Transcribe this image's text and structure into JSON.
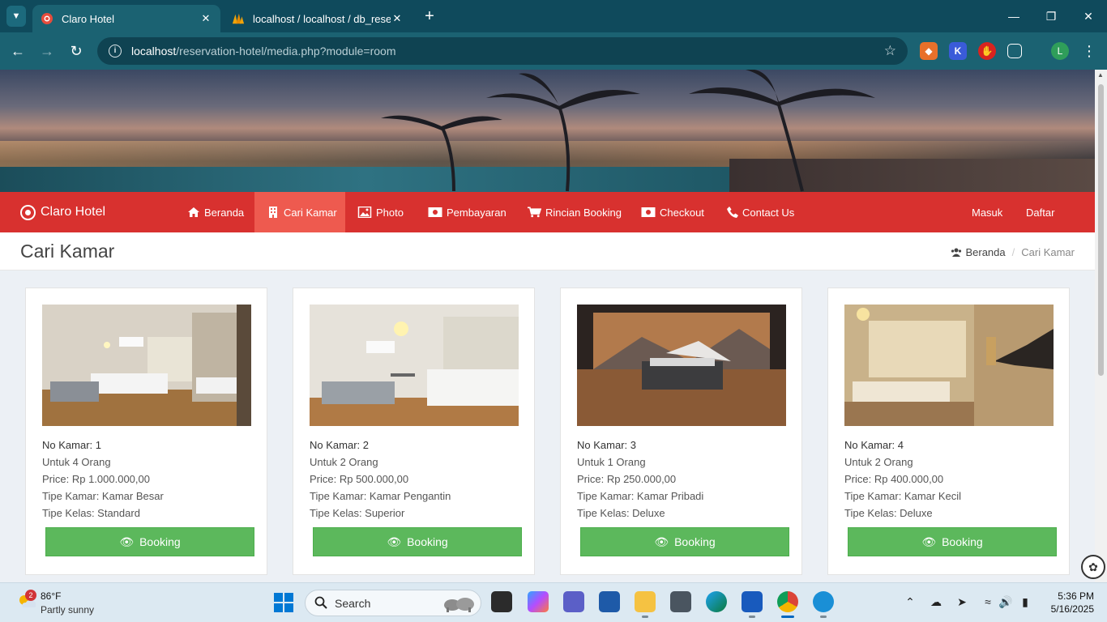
{
  "browser": {
    "tabs": [
      {
        "title": "Claro Hotel",
        "active": true
      },
      {
        "title": "localhost / localhost / db_reservation",
        "active": false
      }
    ],
    "url_host": "localhost",
    "url_path": "/reservation-hotel/media.php?module=room",
    "profile_initial": "L"
  },
  "site": {
    "brand": "Claro Hotel",
    "menu": [
      {
        "label": "Beranda",
        "icon": "home-icon",
        "active": false
      },
      {
        "label": "Cari Kamar",
        "icon": "building-icon",
        "active": true
      },
      {
        "label": "Photo",
        "icon": "image-icon",
        "active": false
      },
      {
        "label": "Pembayaran",
        "icon": "money-icon",
        "active": false
      },
      {
        "label": "Rincian Booking",
        "icon": "cart-icon",
        "active": false
      },
      {
        "label": "Checkout",
        "icon": "money-icon",
        "active": false
      },
      {
        "label": "Contact Us",
        "icon": "phone-icon",
        "active": false
      }
    ],
    "auth": {
      "login": "Masuk",
      "register": "Daftar"
    },
    "page_title": "Cari Kamar",
    "breadcrumb": {
      "home": "Beranda",
      "current": "Cari Kamar"
    },
    "booking_label": "Booking",
    "rooms": [
      {
        "no": "No Kamar: 1",
        "capacity": "Untuk 4 Orang",
        "price": "Price: Rp 1.000.000,00",
        "type": "Tipe Kamar: Kamar Besar",
        "class": "Tipe Kelas: Standard"
      },
      {
        "no": "No Kamar: 2",
        "capacity": "Untuk 2 Orang",
        "price": "Price: Rp 500.000,00",
        "type": "Tipe Kamar: Kamar Pengantin",
        "class": "Tipe Kelas: Superior"
      },
      {
        "no": "No Kamar: 3",
        "capacity": "Untuk 1 Orang",
        "price": "Price: Rp 250.000,00",
        "type": "Tipe Kamar: Kamar Pribadi",
        "class": "Tipe Kelas: Deluxe"
      },
      {
        "no": "No Kamar: 4",
        "capacity": "Untuk 2 Orang",
        "price": "Price: Rp 400.000,00",
        "type": "Tipe Kamar: Kamar Kecil",
        "class": "Tipe Kelas: Deluxe"
      }
    ]
  },
  "taskbar": {
    "weather": {
      "temp": "86°F",
      "condition": "Partly sunny",
      "badge": "2"
    },
    "search_label": "Search",
    "time": "5:36 PM",
    "date": "5/16/2025"
  },
  "colors": {
    "navbar": "#d8312f",
    "nav_active": "#ee5a4f",
    "booking_button": "#5cb85c",
    "browser_frame": "#0f4a5c"
  }
}
